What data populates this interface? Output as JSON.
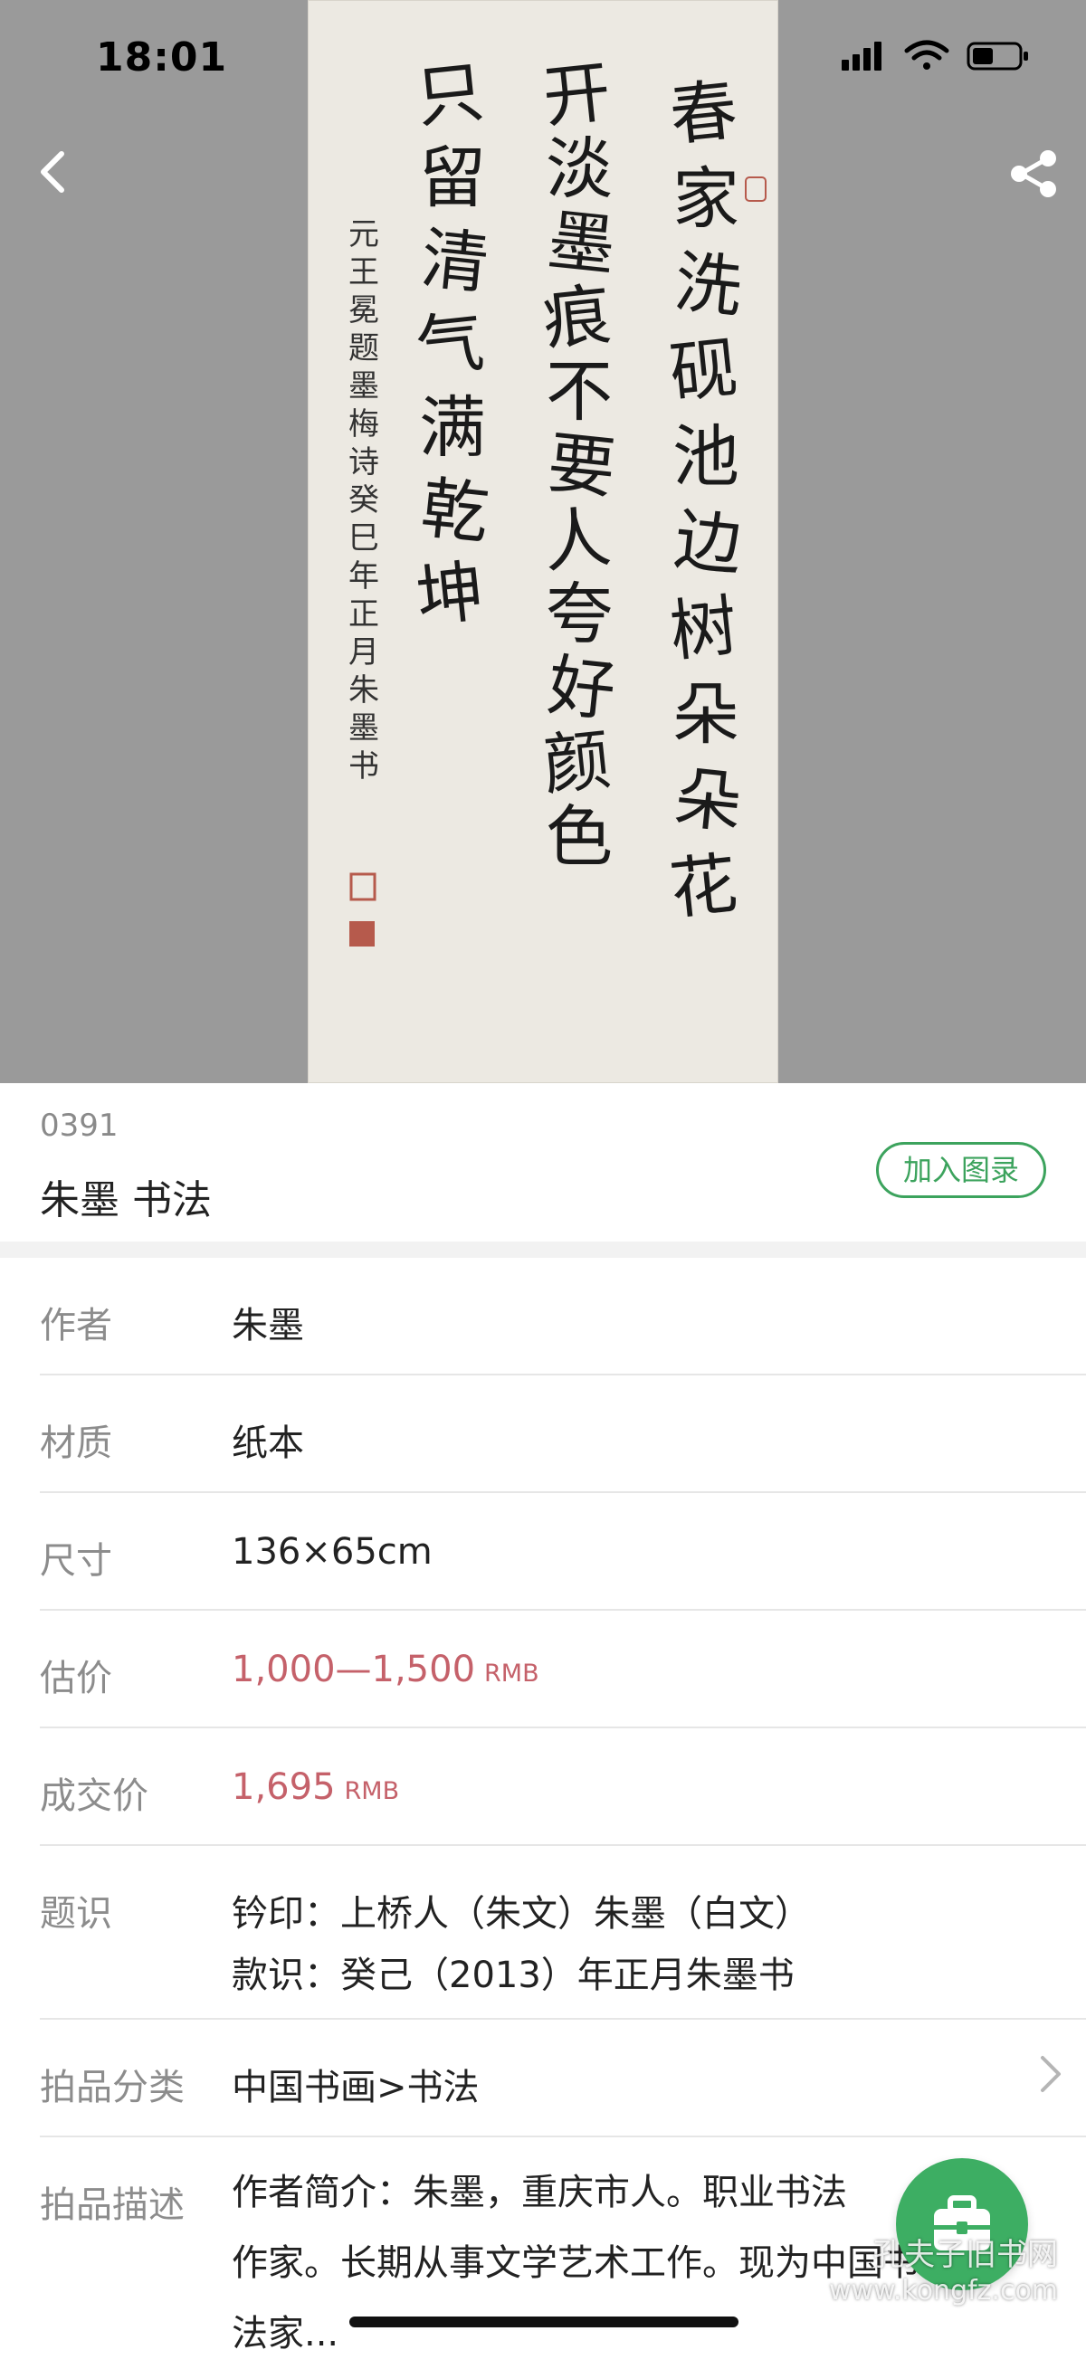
{
  "status_bar": {
    "time": "18:01"
  },
  "artwork": {
    "inscription_main": [
      "春",
      "家",
      "洗",
      "砚",
      "池",
      "边",
      "树",
      "朵",
      "朵",
      "花",
      "开",
      "淡",
      "墨",
      "痕",
      "不",
      "要",
      "人",
      "夸",
      "好",
      "颜",
      "色",
      "只",
      "留",
      "清",
      "气",
      "满",
      "乾",
      "坤"
    ],
    "inscription_side": "元王冕题墨梅诗癸巳年正月朱墨书"
  },
  "lot": {
    "number": "0391",
    "title": "朱墨 书法",
    "add_catalog_label": "加入图录"
  },
  "details": {
    "author_label": "作者",
    "author_value": "朱墨",
    "material_label": "材质",
    "material_value": "纸本",
    "size_label": "尺寸",
    "size_value": "136×65cm",
    "estimate_label": "估价",
    "estimate_value": "1,000—1,500",
    "estimate_unit": "RMB",
    "deal_label": "成交价",
    "deal_value": "1,695",
    "deal_unit": "RMB",
    "inscription_label": "题识",
    "inscription_line1": "钤印：上桥人（朱文）朱墨（白文）",
    "inscription_line2": "款识：癸己（2013）年正月朱墨书",
    "category_label": "拍品分类",
    "category_value": "中国书画>书法",
    "description_label": "拍品描述",
    "description_line1": "作者简介：朱墨，重庆市人。职业书法",
    "description_line2": "作家。长期从事文学艺术工作。现为中国书",
    "description_line3": "法家..."
  },
  "watermark": {
    "line1": "孔夫子旧书网",
    "line2": "www.kongfz.com"
  },
  "colors": {
    "accent_green": "#3ca35d",
    "price_red": "#c5616a",
    "label_gray": "#8c8c8c"
  },
  "icons": {
    "back": "chevron-left-icon",
    "share": "share-icon",
    "chevron": "chevron-right-icon",
    "fab": "briefcase-icon"
  }
}
